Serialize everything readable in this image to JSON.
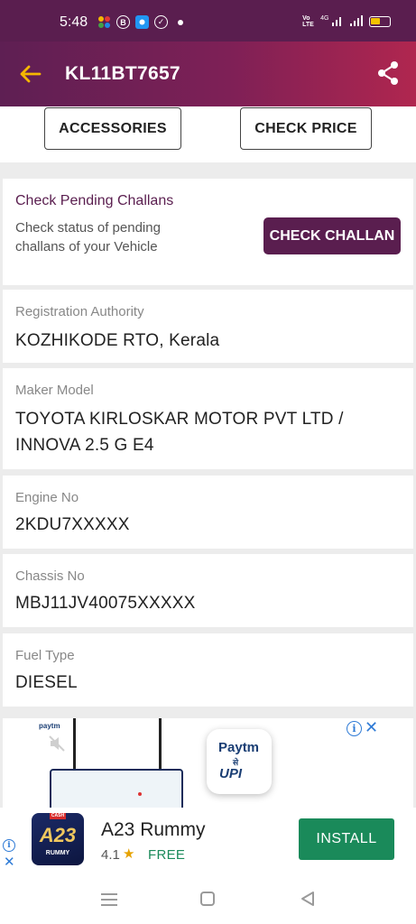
{
  "status_bar": {
    "time": "5:48",
    "icons": [
      "pinwheel-app-icon",
      "b-badge-icon",
      "messaging-app-icon",
      "check-circle-icon",
      "dot-icon"
    ],
    "network_labels": [
      "Vo LTE",
      "4G"
    ],
    "battery_color": "#f2c200"
  },
  "app_bar": {
    "title": "KL11BT7657",
    "back_icon": "arrow-left-icon",
    "share_icon": "share-icon",
    "accent": "#f5b700"
  },
  "actions": {
    "accessories_label": "ACCESSORIES",
    "check_price_label": "CHECK PRICE"
  },
  "challan": {
    "title": "Check Pending Challans",
    "description": "Check status of pending challans of your Vehicle",
    "button_label": "CHECK CHALLAN",
    "color": "#5a1e4f"
  },
  "details": [
    {
      "label": "Registration Authority",
      "value": "KOZHIKODE RTO, Kerala"
    },
    {
      "label": "Maker Model",
      "value": "TOYOTA KIRLOSKAR MOTOR PVT LTD / INNOVA 2.5 G E4"
    },
    {
      "label": "Engine No",
      "value": "2KDU7XXXXX"
    },
    {
      "label": "Chassis No",
      "value": "MBJ11JV40075XXXXX"
    },
    {
      "label": "Fuel Type",
      "value": "DIESEL"
    }
  ],
  "ad": {
    "paytm_small": "paytm",
    "logo_paytm": "Paytm",
    "logo_se": "से",
    "logo_upi": "UPI",
    "info_icon": "info-icon",
    "close_icon": "close-icon"
  },
  "banner_ad": {
    "app_name": "A23 Rummy",
    "icon_cash": "CASH",
    "icon_title": "A23",
    "icon_rummy": "RUMMY",
    "rating": "4.1",
    "star": "★",
    "price": "FREE",
    "install_label": "INSTALL",
    "install_color": "#1a8a5a"
  },
  "nav_bar": {
    "icons": [
      "menu-icon",
      "home-icon",
      "back-triangle-icon"
    ]
  }
}
